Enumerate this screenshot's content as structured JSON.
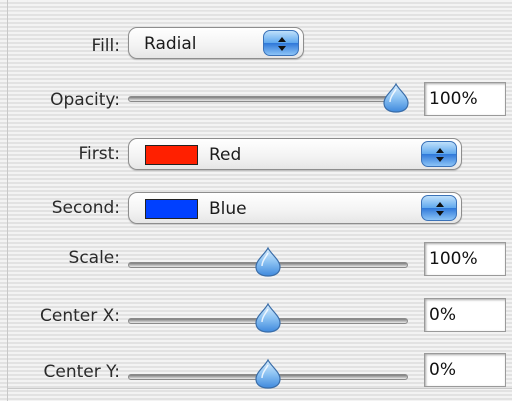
{
  "fill": {
    "label": "Fill:",
    "value": "Radial"
  },
  "opacity": {
    "label": "Opacity:",
    "value": "100%",
    "level": 1.0
  },
  "first": {
    "label": "First:",
    "value": "Red",
    "color": "#ff2000"
  },
  "second": {
    "label": "Second:",
    "value": "Blue",
    "color": "#0040ff"
  },
  "scale": {
    "label": "Scale:",
    "value": "100%",
    "level": 0.5
  },
  "center_x": {
    "label": "Center X:",
    "value": "0%",
    "level": 0.5
  },
  "center_y": {
    "label": "Center Y:",
    "value": "0%",
    "level": 0.5
  },
  "icons": {
    "popup_arrows": "updown-arrows-icon",
    "slider_thumb": "drop-thumb-icon"
  }
}
